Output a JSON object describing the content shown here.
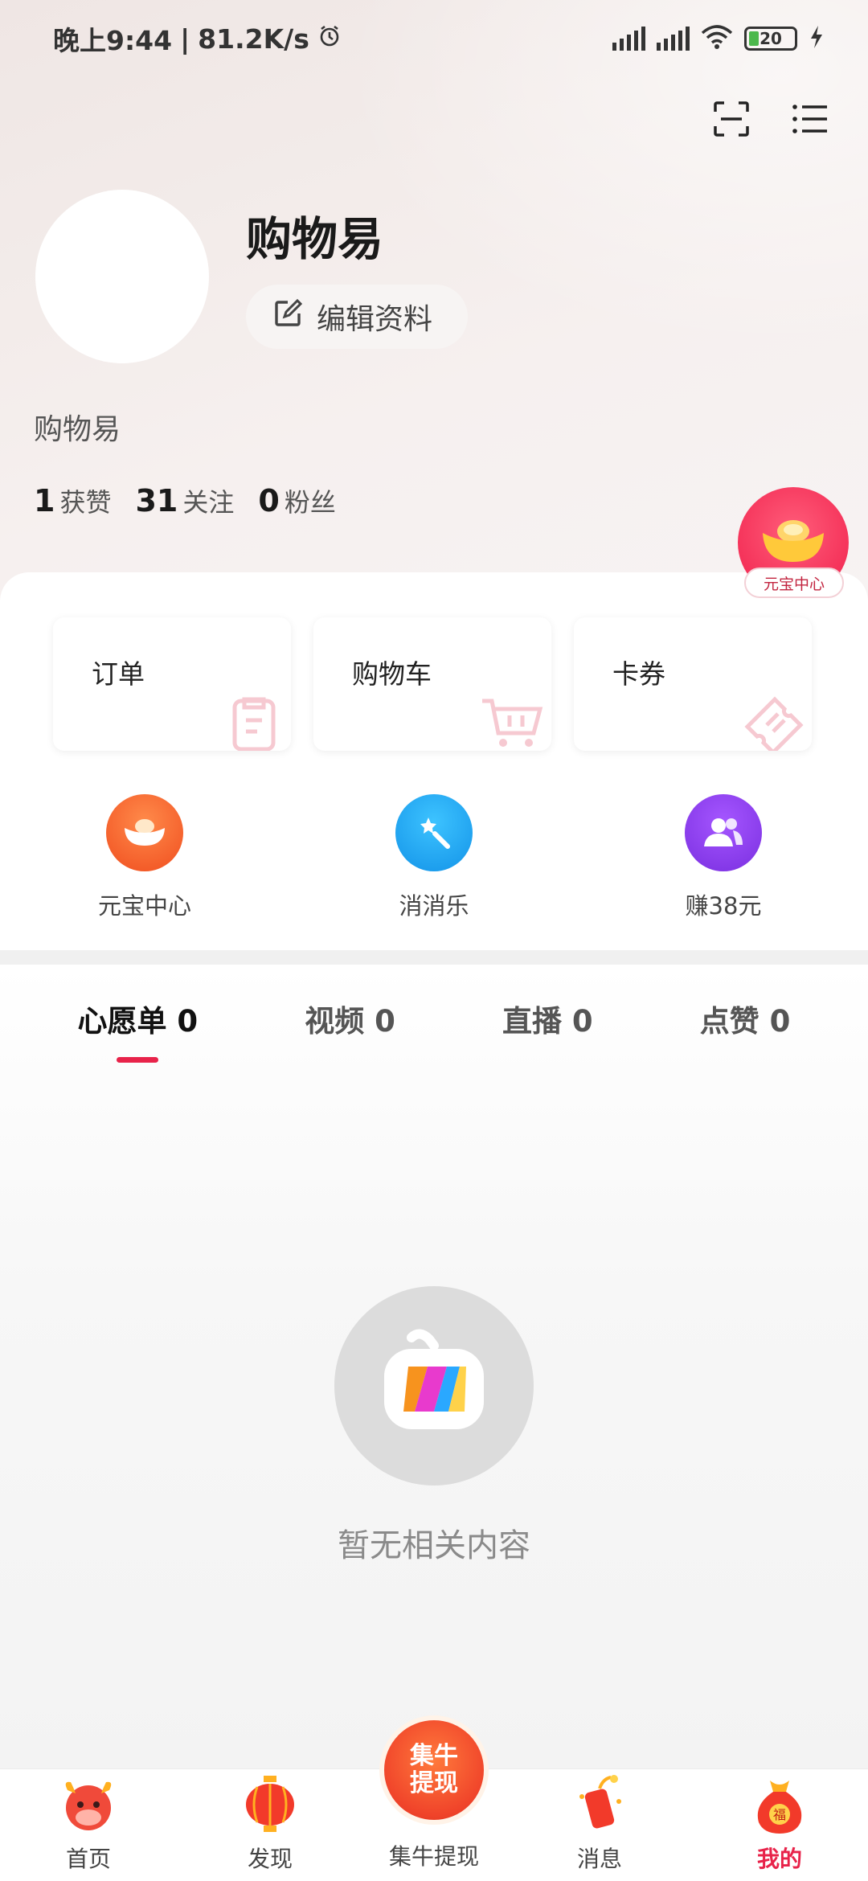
{
  "status_bar": {
    "time": "晚上9:44",
    "speed": "81.2K/s",
    "battery": "20"
  },
  "profile": {
    "username": "购物易",
    "edit_label": "编辑资料",
    "nickname": "购物易",
    "stats": [
      {
        "num": "1",
        "label": "获赞"
      },
      {
        "num": "31",
        "label": "关注"
      },
      {
        "num": "0",
        "label": "粉丝"
      }
    ],
    "yuanbao_tag": "元宝中心"
  },
  "tiles": [
    {
      "label": "订单"
    },
    {
      "label": "购物车"
    },
    {
      "label": "卡券"
    }
  ],
  "shortcuts": [
    {
      "label": "元宝中心",
      "color": "#f5592b"
    },
    {
      "label": "消消乐",
      "color": "#1aa7f0"
    },
    {
      "label": "赚38元",
      "color": "#8b3ee8"
    }
  ],
  "tabs": [
    {
      "label": "心愿单 0"
    },
    {
      "label": "视频 0"
    },
    {
      "label": "直播 0"
    },
    {
      "label": "点赞 0"
    }
  ],
  "empty_text": "暂无相关内容",
  "nav": {
    "items": [
      {
        "label": "首页"
      },
      {
        "label": "发现"
      },
      {
        "label": "集牛提现"
      },
      {
        "label": "消息"
      },
      {
        "label": "我的"
      }
    ],
    "center_badge_line1": "集牛",
    "center_badge_line2": "提现"
  },
  "colors": {
    "accent": "#e8234a"
  }
}
